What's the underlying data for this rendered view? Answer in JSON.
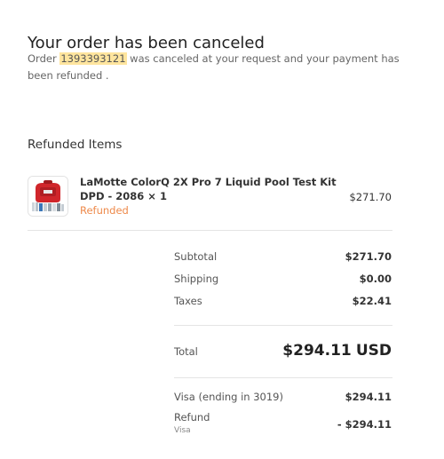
{
  "header": {
    "title": "Your order has been canceled",
    "message_prefix": "Order",
    "order_number": "1393393121",
    "message_suffix": "was canceled at your request and your payment has been refunded ."
  },
  "refunded_items": {
    "title": "Refunded Items",
    "items": [
      {
        "name": "LaMotte ColorQ 2X Pro 7 Liquid Pool Test Kit DPD - 2086 × 1",
        "status": "Refunded",
        "price": "$271.70",
        "thumbnail_icon": "pool-test-kit-image"
      }
    ]
  },
  "summary": {
    "subtotal_label": "Subtotal",
    "subtotal_value": "$271.70",
    "shipping_label": "Shipping",
    "shipping_value": "$0.00",
    "taxes_label": "Taxes",
    "taxes_value": "$22.41",
    "total_label": "Total",
    "total_value": "$294.11",
    "total_currency": "USD"
  },
  "payment": {
    "method_label": "Visa (ending in 3019)",
    "method_value": "$294.11",
    "refund_label": "Refund",
    "refund_sublabel": "Visa",
    "refund_value": "- $294.11"
  },
  "colors": {
    "accent_orange": "#ee8a4b",
    "highlight": "#ffe59e"
  }
}
